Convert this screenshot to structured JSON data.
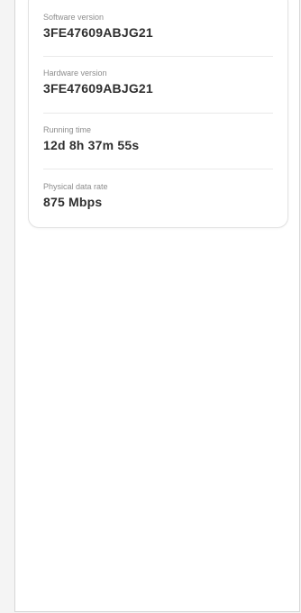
{
  "device_details": {
    "items": [
      {
        "label": "Software version",
        "value": "3FE47609ABJG21"
      },
      {
        "label": "Hardware version",
        "value": "3FE47609ABJG21"
      },
      {
        "label": "Running time",
        "value": "12d 8h 37m 55s"
      },
      {
        "label": "Physical data rate",
        "value": "875 Mbps"
      }
    ]
  }
}
